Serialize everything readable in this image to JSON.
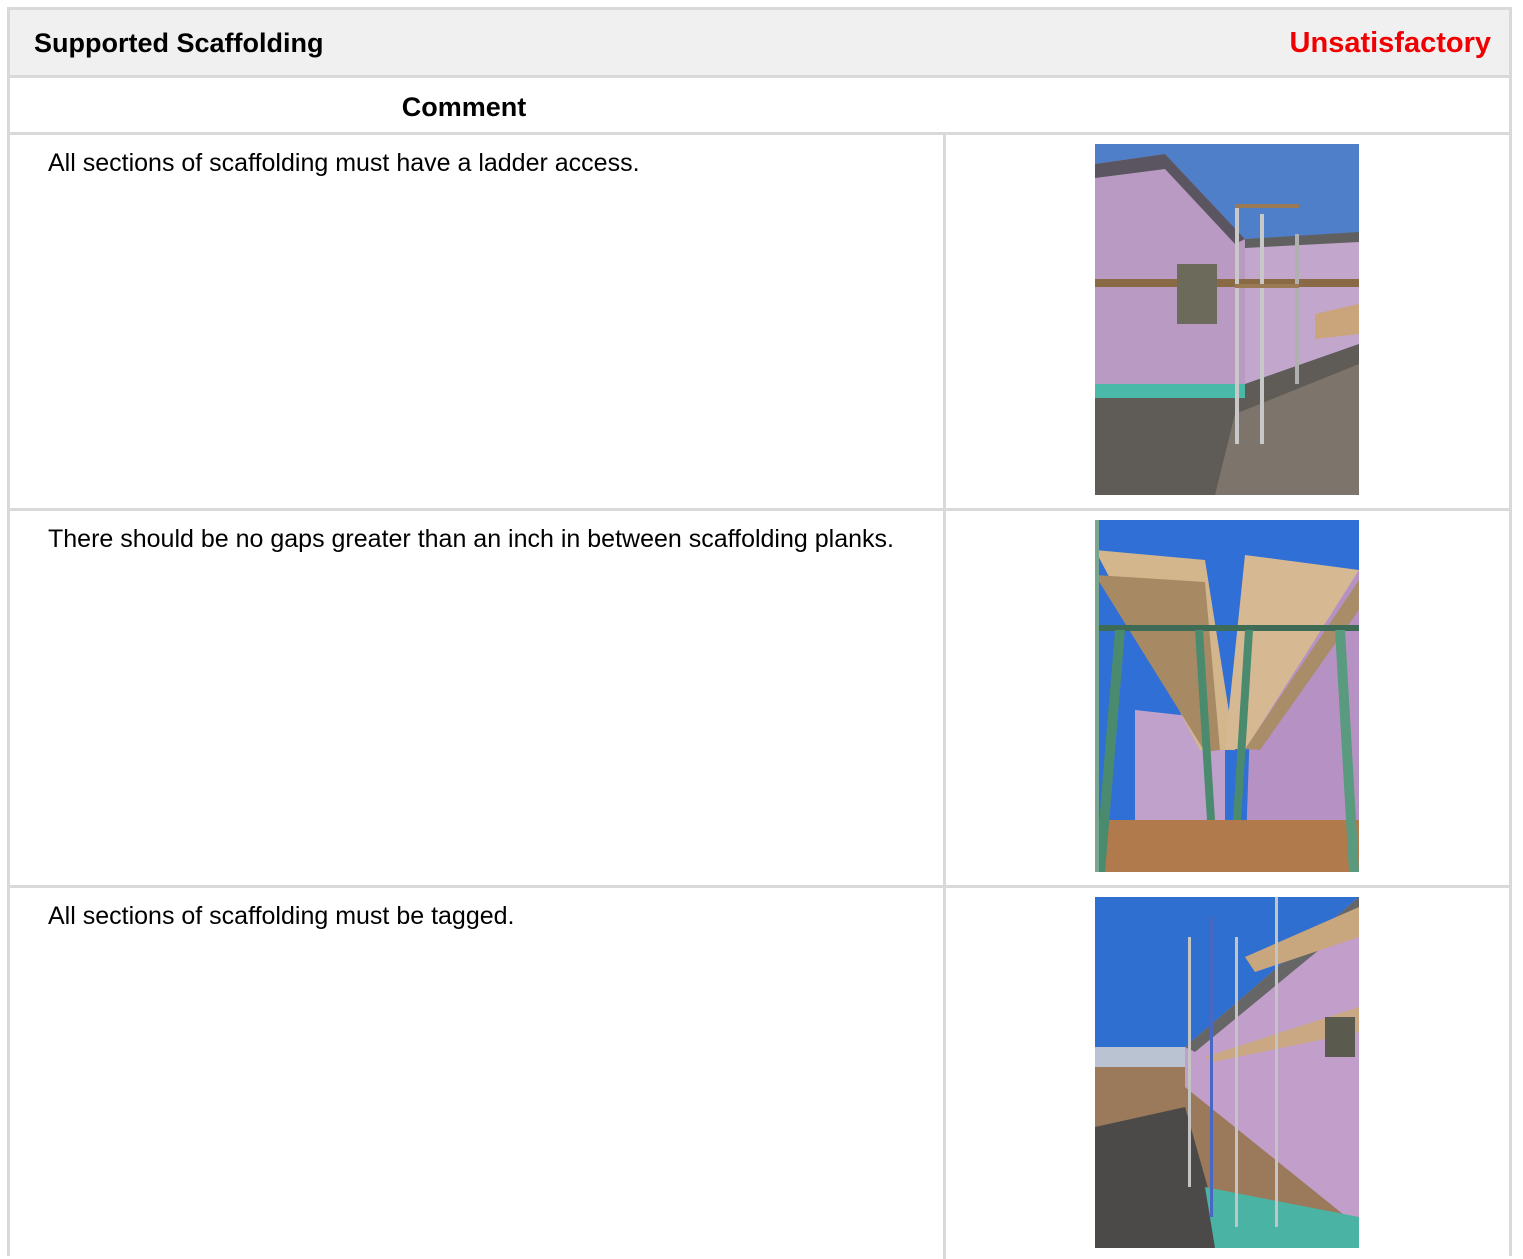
{
  "section": {
    "title": "Supported Scaffolding",
    "status": "Unsatisfactory",
    "status_color": "#f00000"
  },
  "table": {
    "column_header": "Comment"
  },
  "items": [
    {
      "comment": "All sections of scaffolding must have a ladder access.",
      "photo_icon": "scaffolding-photo"
    },
    {
      "comment": "There should be no gaps greater than an inch in between scaffolding planks.",
      "photo_icon": "scaffolding-planks-photo"
    },
    {
      "comment": "All sections of scaffolding must be tagged.",
      "photo_icon": "scaffolding-photo"
    }
  ]
}
